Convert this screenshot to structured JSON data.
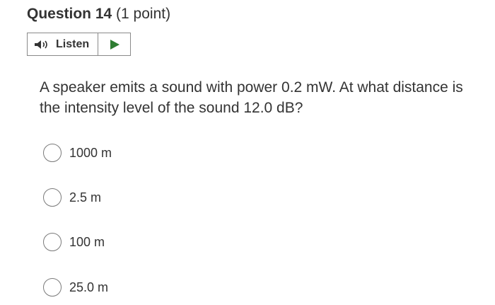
{
  "question": {
    "label": "Question 14",
    "points": "(1 point)"
  },
  "listen": {
    "label": "Listen",
    "speaker_icon": "speaker-icon",
    "play_icon": "play-icon",
    "play_color": "#2e7d32"
  },
  "question_text": "A speaker emits a sound with power 0.2 mW. At what distance is the intensity level of the sound 12.0 dB?",
  "options": [
    {
      "label": "1000 m",
      "selected": false
    },
    {
      "label": "2.5 m",
      "selected": false
    },
    {
      "label": "100 m",
      "selected": false
    },
    {
      "label": "25.0 m",
      "selected": false
    }
  ]
}
